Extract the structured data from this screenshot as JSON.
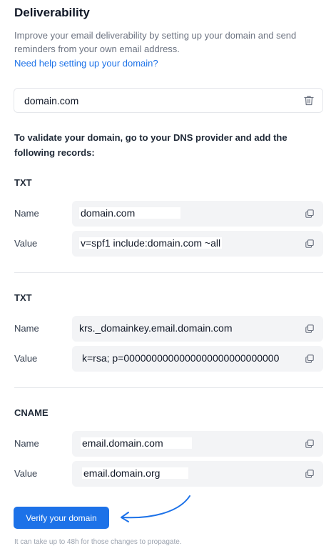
{
  "header": {
    "title": "Deliverability",
    "description": "Improve your email deliverability by setting up your domain and send reminders from your own email address.",
    "help_link": "Need help setting up your domain?"
  },
  "domain": {
    "value": "domain.com",
    "delete_icon": "trash-icon"
  },
  "instructions": "To validate your domain, go to your DNS provider and add the following records:",
  "labels": {
    "name": "Name",
    "value": "Value"
  },
  "records": [
    {
      "type": "TXT",
      "name": "domain.com",
      "value": "v=spf1 include:domain.com ~all"
    },
    {
      "type": "TXT",
      "name": "krs._domainkey.email.domain.com",
      "value": "k=rsa; p=0000000000000000000000000000"
    },
    {
      "type": "CNAME",
      "name": "email.domain.com",
      "value": "email.domain.org"
    }
  ],
  "copy_icon": "copy-icon",
  "verify_button": "Verify your domain",
  "footnote": "It can take up to 48h for those changes to propagate.",
  "colors": {
    "accent": "#1d72e8",
    "field_bg": "#f3f4f6",
    "muted_text": "#6b7280"
  }
}
